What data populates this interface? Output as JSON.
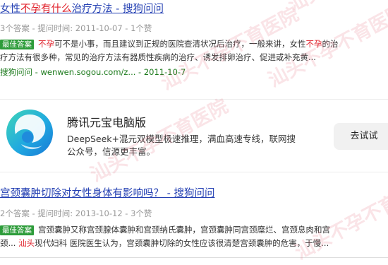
{
  "results": [
    {
      "title_parts": [
        "女性",
        "不孕",
        "有什么",
        "治疗方法 - 搜狗问问"
      ],
      "meta": "3个答案 - 提问时间: 2011-10-07 - 1个赞",
      "line1_parts": [
        "最佳答案",
        "不孕",
        "可不是小事，而且建议到正规的医院查清状况后治疗，一般来讲，女性",
        "不孕",
        "的治"
      ],
      "line2": "疗方法有很多种，常见的治疗方法有器质性疾病的治疗、诱发排卵治疗、促进或补充黄...",
      "source": "搜狗问问 - wenwen.sogou.com/z... - 2011-10-7"
    },
    {
      "title": "宫颈囊肿切除对女性身体有影响吗？ - 搜狗问问",
      "meta": "2个答案 - 提问时间: 2013-10-12 - 3个赞",
      "line1_parts": [
        "最佳答案",
        "宫颈囊肿又称宫颈腺体囊肿和宫颈纳氏囊肿，宫颈囊肿同宫颈糜烂、宫颈息肉和宫"
      ],
      "line2_parts": [
        "颈... ",
        "汕头",
        "现代妇科 医院医生认为，宫颈囊肿切除的女性应该很清楚宫颈囊肿的危害，于慢..."
      ]
    }
  ],
  "ad": {
    "title": "腾讯元宝电脑版",
    "desc": "DeepSeek+混元双模型极速推理，满血高速专线，联网搜公众号，信源更丰富。",
    "button": "去试试",
    "logo_icon": "yuanbao-logo-icon"
  },
  "watermark": "汕头不孕不育医院"
}
